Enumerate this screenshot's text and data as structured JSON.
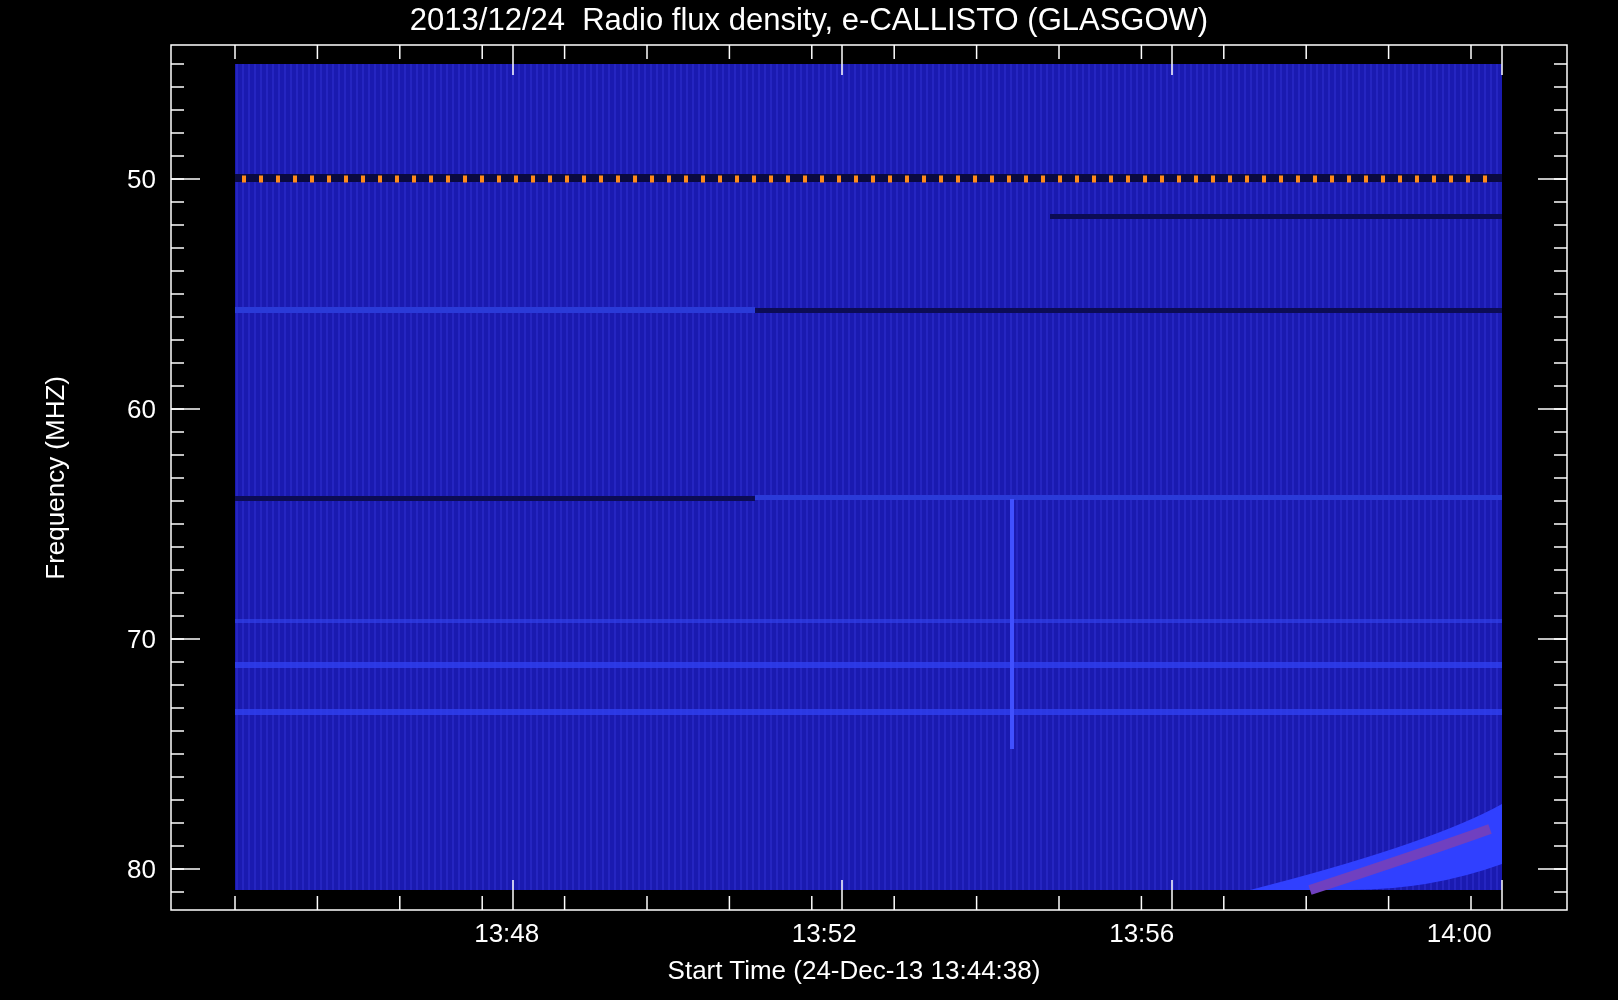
{
  "title": "2013/12/24  Radio flux density, e-CALLISTO (GLASGOW)",
  "y_axis": {
    "label": "Frequency (MHZ)",
    "ticks": [
      "50",
      "60",
      "70",
      "80"
    ]
  },
  "x_axis": {
    "label": "Start Time (24-Dec-13 13:44:38)",
    "ticks": [
      "13:48",
      "13:52",
      "13:56",
      "14:00"
    ]
  }
}
